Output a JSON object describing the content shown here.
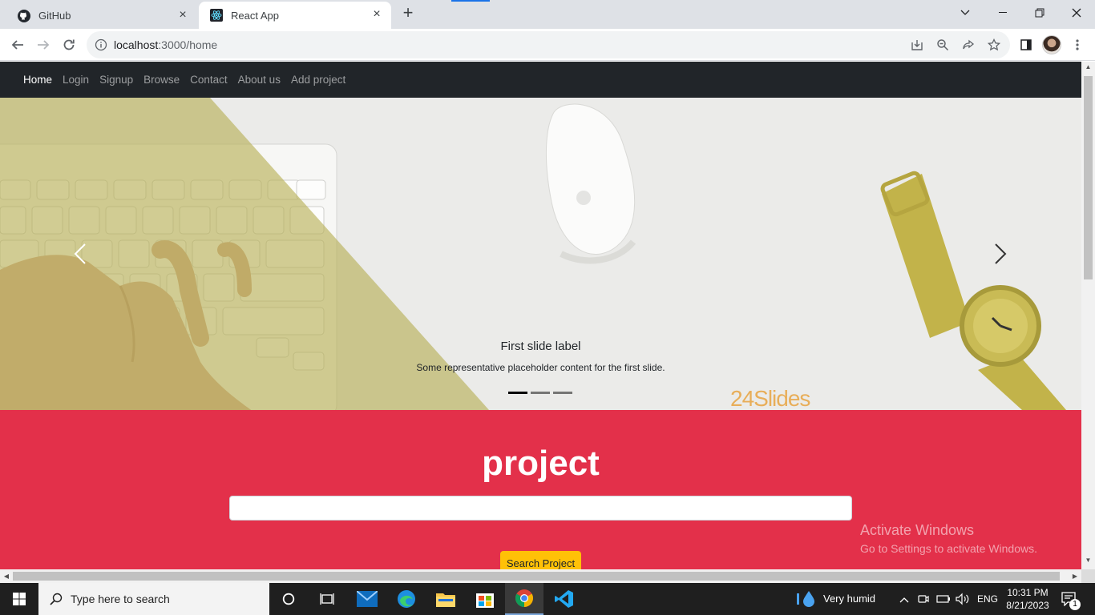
{
  "browser": {
    "tabs": [
      {
        "title": "GitHub",
        "icon": "github-icon"
      },
      {
        "title": "React App",
        "icon": "react-icon",
        "active": true
      }
    ],
    "url_host": "localhost",
    "url_rest": ":3000/home"
  },
  "navbar": {
    "items": [
      "Home",
      "Login",
      "Signup",
      "Browse",
      "Contact",
      "About us",
      "Add project"
    ]
  },
  "carousel": {
    "caption_title": "First slide label",
    "caption_text": "Some representative placeholder content for the first slide.",
    "brand_watermark": "24Slides",
    "slide_count": 3,
    "active_slide": 1
  },
  "project": {
    "title": "project",
    "search_value": "",
    "button_label": "Search Project"
  },
  "activation_notice": {
    "line1": "Activate Windows",
    "line2": "Go to Settings to activate Windows."
  },
  "taskbar": {
    "search_placeholder": "Type here to search",
    "weather": "Very humid",
    "language": "ENG",
    "time": "10:31 PM",
    "date": "8/21/2023",
    "notification_count": "1"
  },
  "colors": {
    "navbar_bg": "#212529",
    "project_bg": "#e3304a",
    "button_bg": "#ffc107"
  }
}
